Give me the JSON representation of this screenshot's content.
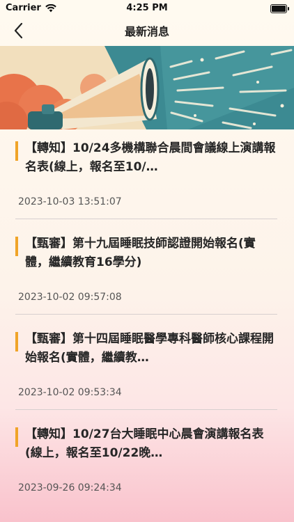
{
  "status": {
    "carrier": "Carrier",
    "time": "4:25 PM"
  },
  "nav": {
    "title": "最新消息",
    "back_icon": "chevron-left-icon"
  },
  "banner": {
    "image": "megaphone-illustration",
    "colors": {
      "sky_top": "#f2dfbd",
      "teal": "#3c8a92",
      "megaphone": "#f3e7cf",
      "cloud": "#e8734a"
    }
  },
  "news": [
    {
      "title": "【轉知】10/24多機構聯合晨間會議線上演講報名表(線上，報名至10/…",
      "date": "2023-10-03 13:51:07"
    },
    {
      "title": "【甄審】第十九屆睡眠技師認證開始報名(實體，繼續教育16學分)",
      "date": "2023-10-02 09:57:08"
    },
    {
      "title": "【甄審】第十四屆睡眠醫學專科醫師核心課程開始報名(實體，繼續教…",
      "date": "2023-10-02 09:53:34"
    },
    {
      "title": "【轉知】10/27台大睡眠中心晨會演講報名表(線上，報名至10/22晚…",
      "date": "2023-09-26 09:24:34"
    }
  ],
  "accent_color": "#f0a428"
}
